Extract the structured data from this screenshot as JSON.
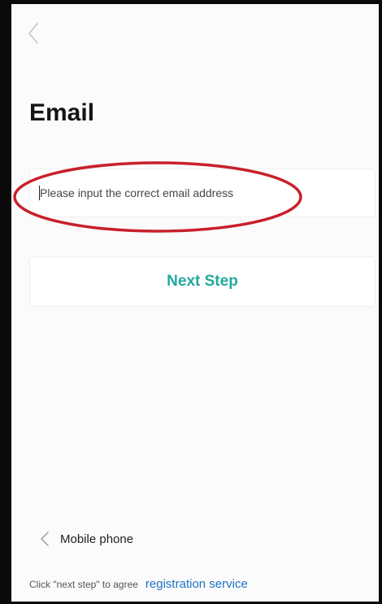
{
  "header": {
    "back_icon": "chevron-left-icon"
  },
  "page": {
    "title": "Email"
  },
  "email_field": {
    "value": "",
    "placeholder": "Please input the correct email address"
  },
  "next_button": {
    "label": "Next Step",
    "color": "#22a99e"
  },
  "switch_link": {
    "icon": "chevron-left-icon",
    "label": "Mobile phone"
  },
  "footer": {
    "agree_text": "Click \"next step\" to agree",
    "agree_link": "registration service",
    "link_color": "#1e72c4"
  },
  "annotation": {
    "shape": "ellipse",
    "color": "#c8202b"
  }
}
